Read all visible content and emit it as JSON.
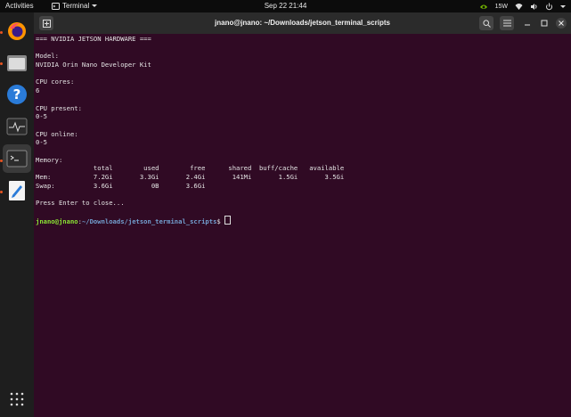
{
  "topbar": {
    "activities": "Activities",
    "app_name": "Terminal",
    "clock": "Sep 22  21:44",
    "power_label": "15W"
  },
  "dock": {
    "items": [
      "firefox-icon",
      "files-icon",
      "help-icon",
      "system-monitor-icon",
      "terminal-icon",
      "text-editor-icon"
    ],
    "apps_grid_icon": "apps-grid-icon"
  },
  "window": {
    "title": "jnano@jnano: ~/Downloads/jetson_terminal_scripts"
  },
  "terminal": {
    "lines": [
      "=== NVIDIA JETSON HARDWARE ===",
      "",
      "Model:",
      "NVIDIA Orin Nano Developer Kit",
      "",
      "CPU cores:",
      "6",
      "",
      "CPU present:",
      "0-5",
      "",
      "CPU online:",
      "0-5",
      "",
      "Memory:",
      "               total        used        free      shared  buff/cache   available",
      "Mem:           7.2Gi       3.3Gi       2.4Gi       141Mi       1.5Gi       3.5Gi",
      "Swap:          3.6Gi          0B       3.6Gi",
      "",
      "Press Enter to close...",
      ""
    ],
    "prompt_user": "jnano@jnano",
    "prompt_sep": ":",
    "prompt_path": "~/Downloads/jetson_terminal_scripts",
    "prompt_symbol": "$ "
  },
  "colors": {
    "terminal_bg": "#300a24",
    "prompt_user": "#8ae234",
    "prompt_path": "#729fcf",
    "accent": "#e95420"
  }
}
